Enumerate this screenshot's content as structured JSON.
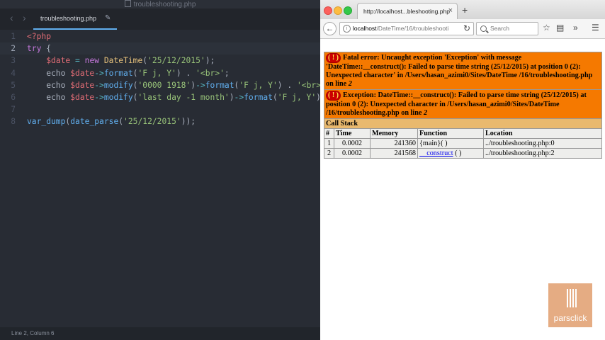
{
  "editor": {
    "window_title": "troubleshooting.php",
    "tab_label": "troubleshooting.php",
    "status": "Line 2, Column 6",
    "lines": [
      {
        "n": "1",
        "tokens": [
          {
            "t": "<?php",
            "c": "tag"
          }
        ]
      },
      {
        "n": "2",
        "tokens": [
          {
            "t": "try",
            "c": "kw"
          },
          {
            "t": " {",
            "c": "pl"
          }
        ]
      },
      {
        "n": "3",
        "tokens": [
          {
            "t": "    ",
            "c": "pl"
          },
          {
            "t": "$date",
            "c": "var"
          },
          {
            "t": " = ",
            "c": "op"
          },
          {
            "t": "new",
            "c": "kw"
          },
          {
            "t": " ",
            "c": "pl"
          },
          {
            "t": "DateTime",
            "c": "cls"
          },
          {
            "t": "(",
            "c": "pl"
          },
          {
            "t": "'25/12/2015'",
            "c": "str"
          },
          {
            "t": ");",
            "c": "pl"
          }
        ]
      },
      {
        "n": "4",
        "tokens": [
          {
            "t": "    echo ",
            "c": "pl"
          },
          {
            "t": "$date",
            "c": "var"
          },
          {
            "t": "->",
            "c": "op"
          },
          {
            "t": "format",
            "c": "fn"
          },
          {
            "t": "(",
            "c": "pl"
          },
          {
            "t": "'F j, Y'",
            "c": "str"
          },
          {
            "t": ") . ",
            "c": "pl"
          },
          {
            "t": "'<br>'",
            "c": "str"
          },
          {
            "t": ";",
            "c": "pl"
          }
        ]
      },
      {
        "n": "5",
        "tokens": [
          {
            "t": "    echo ",
            "c": "pl"
          },
          {
            "t": "$date",
            "c": "var"
          },
          {
            "t": "->",
            "c": "op"
          },
          {
            "t": "modify",
            "c": "fn"
          },
          {
            "t": "(",
            "c": "pl"
          },
          {
            "t": "'0000 1918'",
            "c": "str"
          },
          {
            "t": ")",
            "c": "pl"
          },
          {
            "t": "->",
            "c": "op"
          },
          {
            "t": "format",
            "c": "fn"
          },
          {
            "t": "(",
            "c": "pl"
          },
          {
            "t": "'F j, Y'",
            "c": "str"
          },
          {
            "t": ") . ",
            "c": "pl"
          },
          {
            "t": "'<br>",
            "c": "str"
          }
        ]
      },
      {
        "n": "6",
        "tokens": [
          {
            "t": "    echo ",
            "c": "pl"
          },
          {
            "t": "$date",
            "c": "var"
          },
          {
            "t": "->",
            "c": "op"
          },
          {
            "t": "modify",
            "c": "fn"
          },
          {
            "t": "(",
            "c": "pl"
          },
          {
            "t": "'last day -1 month'",
            "c": "str"
          },
          {
            "t": ")",
            "c": "pl"
          },
          {
            "t": "->",
            "c": "op"
          },
          {
            "t": "format",
            "c": "fn"
          },
          {
            "t": "(",
            "c": "pl"
          },
          {
            "t": "'F j, Y'",
            "c": "str"
          },
          {
            "t": ")",
            "c": "pl"
          }
        ]
      },
      {
        "n": "7",
        "tokens": [
          {
            "t": "",
            "c": "pl"
          }
        ]
      },
      {
        "n": "8",
        "tokens": [
          {
            "t": "var_dump",
            "c": "fn"
          },
          {
            "t": "(",
            "c": "pl"
          },
          {
            "t": "date_parse",
            "c": "fn"
          },
          {
            "t": "(",
            "c": "pl"
          },
          {
            "t": "'25/12/2015'",
            "c": "str"
          },
          {
            "t": "));",
            "c": "pl"
          }
        ]
      }
    ],
    "active_line": 2
  },
  "browser": {
    "tab_title": "http://localhost...bleshooting.php",
    "url_host": "localhost",
    "url_path": "/DateTime/16/troubleshootin",
    "search_placeholder": "Search",
    "error1": {
      "bang": "( ! )",
      "text": "Fatal error: Uncaught exception 'Exception' with message 'DateTime::__construct(): Failed to parse time string (25/12/2015) at position 0 (2): Unexpected character' in /Users/hasan_azimi0/Sites/DateTime /16/troubleshooting.php on line ",
      "line": "2"
    },
    "error2": {
      "bang": "( ! )",
      "text": "Exception: DateTime::__construct(): Failed to parse time string (25/12/2015) at position 0 (2): Unexpected character in /Users/hasan_azimi0/Sites/DateTime /16/troubleshooting.php on line ",
      "line": "2"
    },
    "call_stack": {
      "title": "Call Stack",
      "columns": [
        "#",
        "Time",
        "Memory",
        "Function",
        "Location"
      ],
      "rows": [
        {
          "n": "1",
          "time": "0.0002",
          "memory": "241360",
          "func": "{main}( )",
          "func_link": "",
          "func_args": "",
          "location": "../troubleshooting.php:0"
        },
        {
          "n": "2",
          "time": "0.0002",
          "memory": "241568",
          "func": "",
          "func_link": "__construct",
          "func_args": " ( )",
          "location": "../troubleshooting.php:2"
        }
      ]
    }
  },
  "logo": {
    "text": "parsclick"
  }
}
